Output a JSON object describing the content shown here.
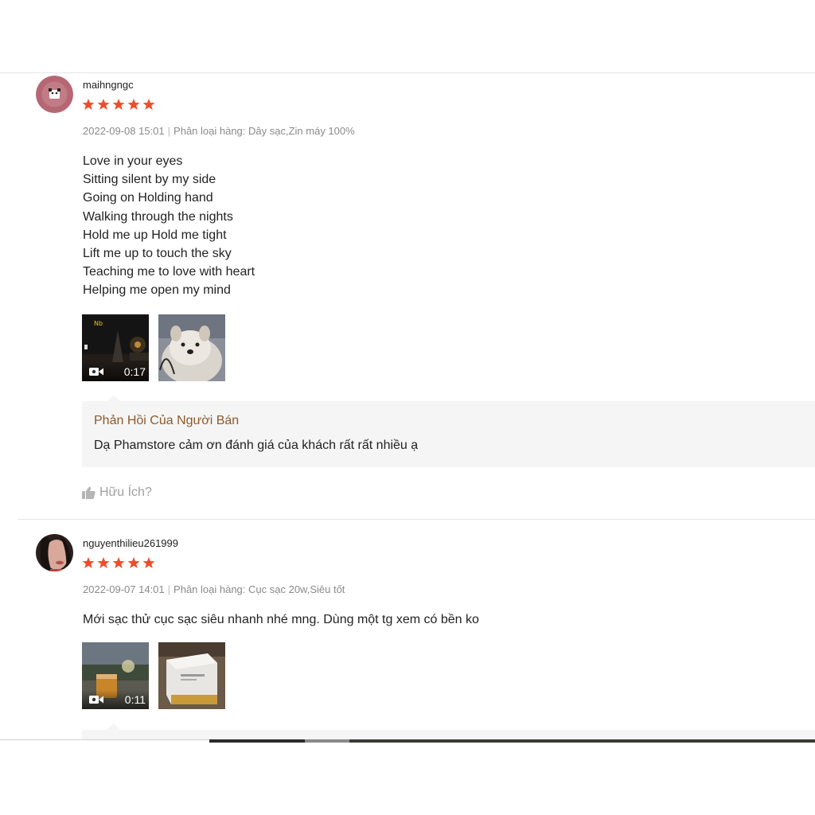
{
  "reviews": [
    {
      "username": "maihngngc",
      "rating": 5,
      "date": "2022-09-08 15:01",
      "separator": "|",
      "variation": "Phân loại hàng: Dây sạc,Zin máy 100%",
      "content_lines": [
        "Love in your eyes",
        "Sitting silent by my side",
        "Going on Holding hand",
        "Walking through the nights",
        "Hold me up Hold me tight",
        "Lift me up to touch the sky",
        "Teaching me to love with heart",
        "Helping me open my mind"
      ],
      "video_duration": "0:17",
      "video_watermark": "Nb",
      "seller_reply_title": "Phản Hồi Của Người Bán",
      "seller_reply_text": "Dạ Phamstore cảm ơn đánh giá của khách rất rất nhiều ạ",
      "helpful_label": "Hữu Ích?"
    },
    {
      "username": "nguyenthilieu261999",
      "rating": 5,
      "date": "2022-09-07 14:01",
      "separator": "|",
      "variation": "Phân loại hàng: Cục sạc 20w,Siêu tốt",
      "content_lines": [
        "Mới sạc thử cục sạc siêu nhanh nhé mng. Dùng một tg xem có bền ko"
      ],
      "video_duration": "0:11"
    }
  ],
  "icons": {
    "star": "star-icon",
    "video": "video-camera-icon",
    "thumb_up": "thumbs-up-icon"
  },
  "colors": {
    "star": "#ee4d2d",
    "seller_title": "#8c5a2b",
    "meta": "#8a8a8a",
    "reply_bg": "#f5f5f5"
  }
}
